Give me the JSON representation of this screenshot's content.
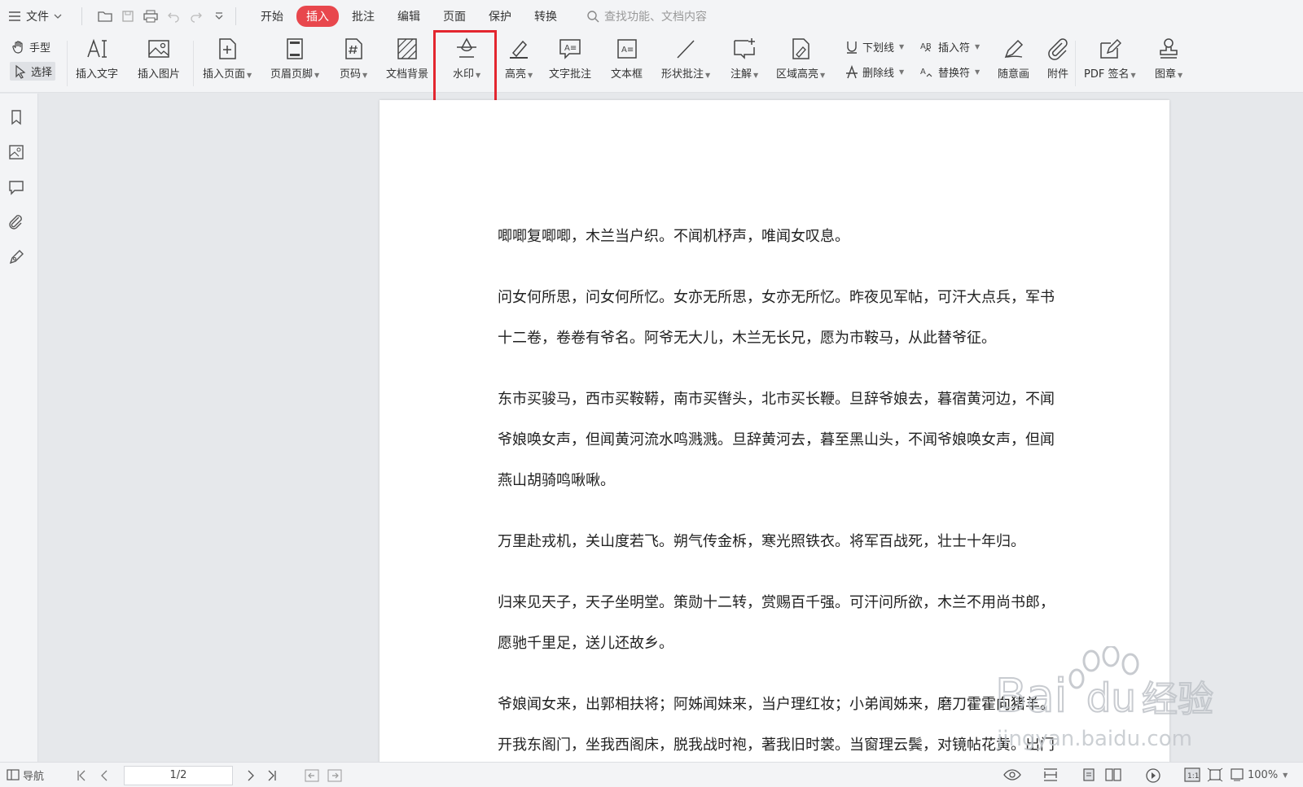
{
  "menubar": {
    "file_label": "文件",
    "tabs": [
      "开始",
      "插入",
      "批注",
      "编辑",
      "页面",
      "保护",
      "转换"
    ],
    "active_tab": "插入",
    "search_placeholder": "查找功能、文档内容"
  },
  "ribbon": {
    "hand_label": "手型",
    "select_label": "选择",
    "tools": {
      "insert_text": "插入文字",
      "insert_image": "插入图片",
      "insert_page": "插入页面",
      "header_footer": "页眉页脚",
      "page_number": "页码",
      "doc_background": "文档背景",
      "watermark": "水印",
      "highlight": "高亮",
      "text_comment": "文字批注",
      "text_box": "文本框",
      "shape_comment": "形状批注",
      "annotation": "注解",
      "area_highlight": "区域高亮",
      "underline": "下划线",
      "strikethrough": "删除线",
      "insert_symbol": "插入符",
      "replace_symbol": "替换符",
      "freehand": "随意画",
      "attachment": "附件",
      "pdf_sign": "PDF 签名",
      "stamp": "图章"
    }
  },
  "document": {
    "paragraphs": [
      [
        "唧唧复唧唧，木兰当户织。不闻机杼声，唯闻女叹息。"
      ],
      [
        "问女何所思，问女何所忆。女亦无所思，女亦无所忆。昨夜见军帖，可汗大点兵，军书",
        "十二卷，卷卷有爷名。阿爷无大儿，木兰无长兄，愿为市鞍马，从此替爷征。"
      ],
      [
        "东市买骏马，西市买鞍鞯，南市买辔头，北市买长鞭。旦辞爷娘去，暮宿黄河边，不闻",
        "爷娘唤女声，但闻黄河流水鸣溅溅。旦辞黄河去，暮至黑山头，不闻爷娘唤女声，但闻",
        "燕山胡骑鸣啾啾。"
      ],
      [
        "万里赴戎机，关山度若飞。朔气传金柝，寒光照铁衣。将军百战死，壮士十年归。"
      ],
      [
        "归来见天子，天子坐明堂。策勋十二转，赏赐百千强。可汗问所欲，木兰不用尚书郎，",
        "愿驰千里足，送儿还故乡。"
      ],
      [
        "爷娘闻女来，出郭相扶将；阿姊闻妹来，当户理红妆；小弟闻姊来，磨刀霍霍向猪羊。",
        "开我东阁门，坐我西阁床，脱我战时袍，著我旧时裳。当窗理云鬓，对镜帖花黄。出门"
      ]
    ]
  },
  "watermark_overlay": {
    "brand": "Baidu经验",
    "url": "jingyan.baidu.com"
  },
  "statusbar": {
    "nav_label": "导航",
    "page_indicator": "1/2",
    "zoom": "100%"
  },
  "colors": {
    "accent": "#e8474d",
    "highlight_box": "#e3262f"
  }
}
